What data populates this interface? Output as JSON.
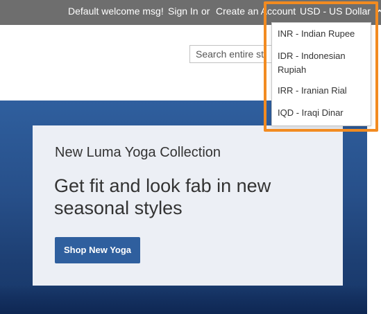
{
  "top_bar": {
    "welcome_text": "Default welcome msg!",
    "sign_in_label": "Sign In",
    "or_text": "or",
    "create_account_label": "Create an Account",
    "currency_label": "USD - US Dollar",
    "currency_icon": "chevron-up-icon"
  },
  "search": {
    "placeholder": "Search entire store here..."
  },
  "hero": {
    "kicker": "New Luma Yoga Collection",
    "headline": "Get fit and look fab in new seasonal styles",
    "cta_label": "Shop New Yoga"
  },
  "currency_dropdown": {
    "options": [
      {
        "label": "INR - Indian Rupee"
      },
      {
        "label": "IDR - Indonesian Rupiah"
      },
      {
        "label": "IRR - Iranian Rial"
      },
      {
        "label": "IQD - Iraqi Dinar"
      }
    ]
  },
  "colors": {
    "top_bar_bg": "#6e6e6e",
    "accent_orange": "#f28b21",
    "hero_blue": "#2f5f9e",
    "panel_bg": "#eceff5"
  }
}
